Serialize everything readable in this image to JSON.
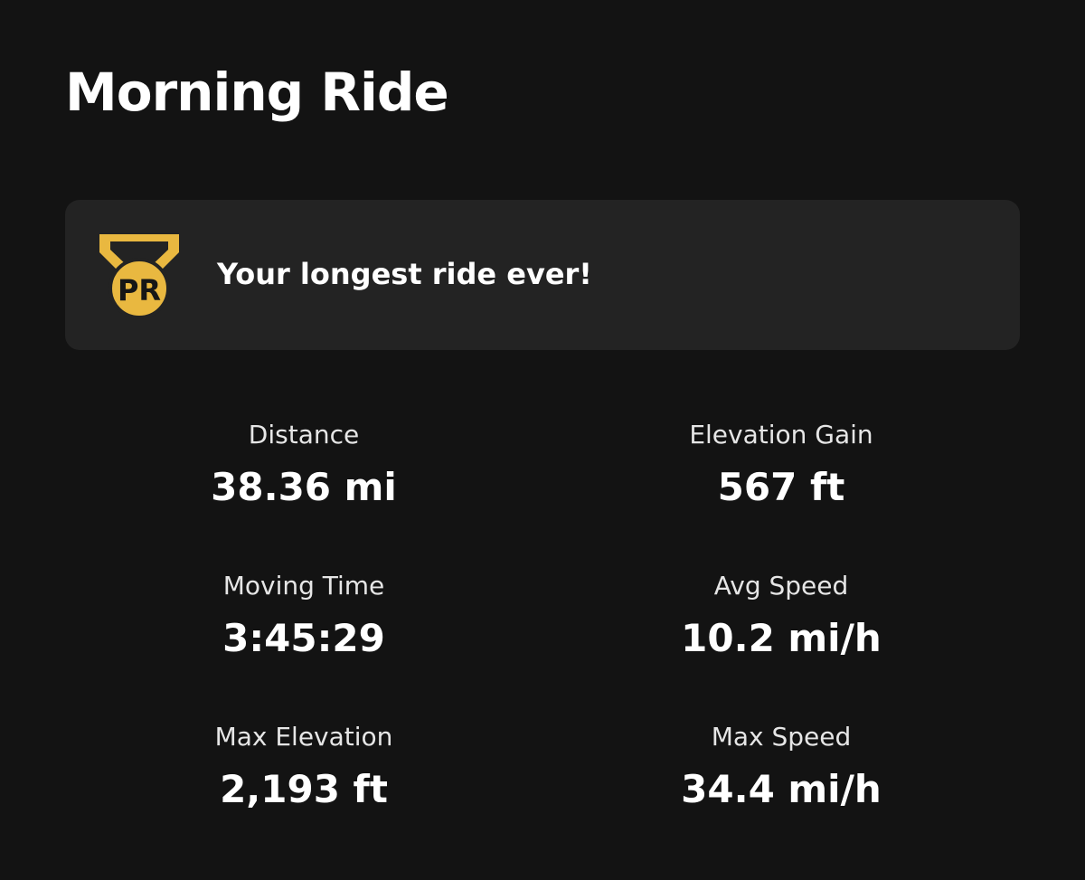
{
  "activity": {
    "title": "Morning Ride"
  },
  "achievement": {
    "icon": "pr-medal-icon",
    "badge_text": "PR",
    "message": "Your longest ride ever!",
    "accent_color": "#e9b840"
  },
  "stats": [
    {
      "label": "Distance",
      "value": "38.36 mi"
    },
    {
      "label": "Elevation Gain",
      "value": "567 ft"
    },
    {
      "label": "Moving Time",
      "value": "3:45:29"
    },
    {
      "label": "Avg Speed",
      "value": "10.2 mi/h"
    },
    {
      "label": "Max Elevation",
      "value": "2,193 ft"
    },
    {
      "label": "Max Speed",
      "value": "34.4 mi/h"
    }
  ]
}
